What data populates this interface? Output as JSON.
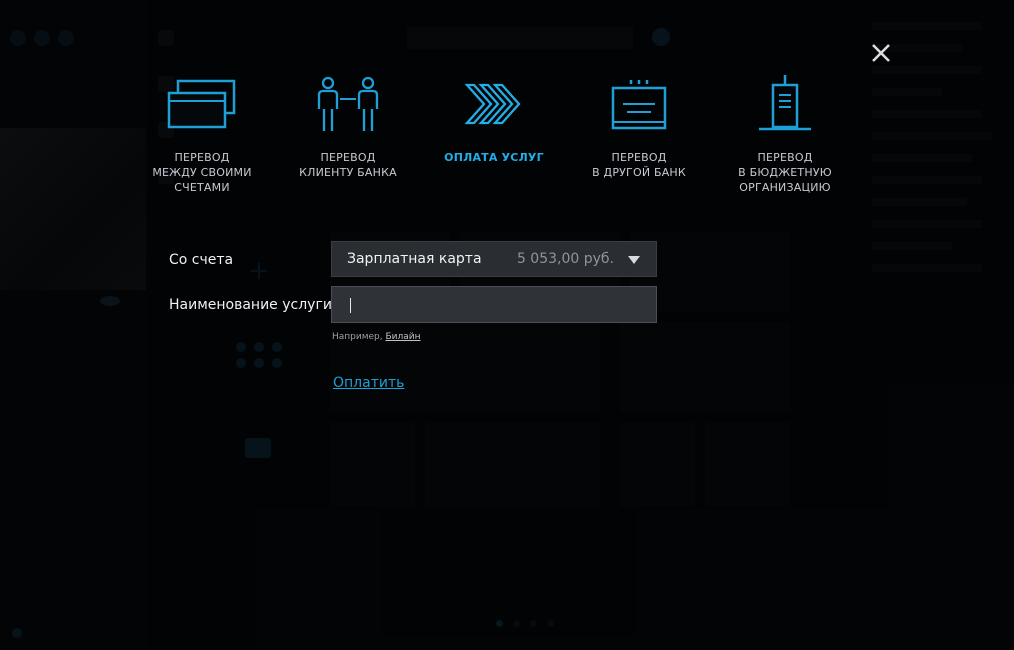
{
  "modal": {
    "transfer_types": [
      {
        "label": "ПЕРЕВОД\nМЕЖДУ СВОИМИ\nСЧЕТАМИ",
        "icon": "cards-icon",
        "active": false
      },
      {
        "label": "ПЕРЕВОД\nКЛИЕНТУ БАНКА",
        "icon": "people-icon",
        "active": false
      },
      {
        "label": "ОПЛАТА УСЛУГ",
        "icon": "chevrons-icon",
        "active": true
      },
      {
        "label": "ПЕРЕВОД\nВ ДРУГОЙ БАНК",
        "icon": "bank-document-icon",
        "active": false
      },
      {
        "label": "ПЕРЕВОД\nВ БЮДЖЕТНУЮ\nОРГАНИЗАЦИЮ",
        "icon": "budget-document-icon",
        "active": false
      }
    ],
    "form": {
      "from_account_label": "Со счета",
      "account_name": "Зарплатная карта",
      "account_balance": "5 053,00 руб.",
      "service_name_label": "Наименование услуги",
      "service_input_value": "",
      "hint_prefix": "Например, ",
      "hint_example": "Билайн",
      "pay_link": "Оплатить"
    }
  },
  "colors": {
    "accent": "#22aee6",
    "link": "#1e9fd6",
    "overlay": "#05080b"
  }
}
